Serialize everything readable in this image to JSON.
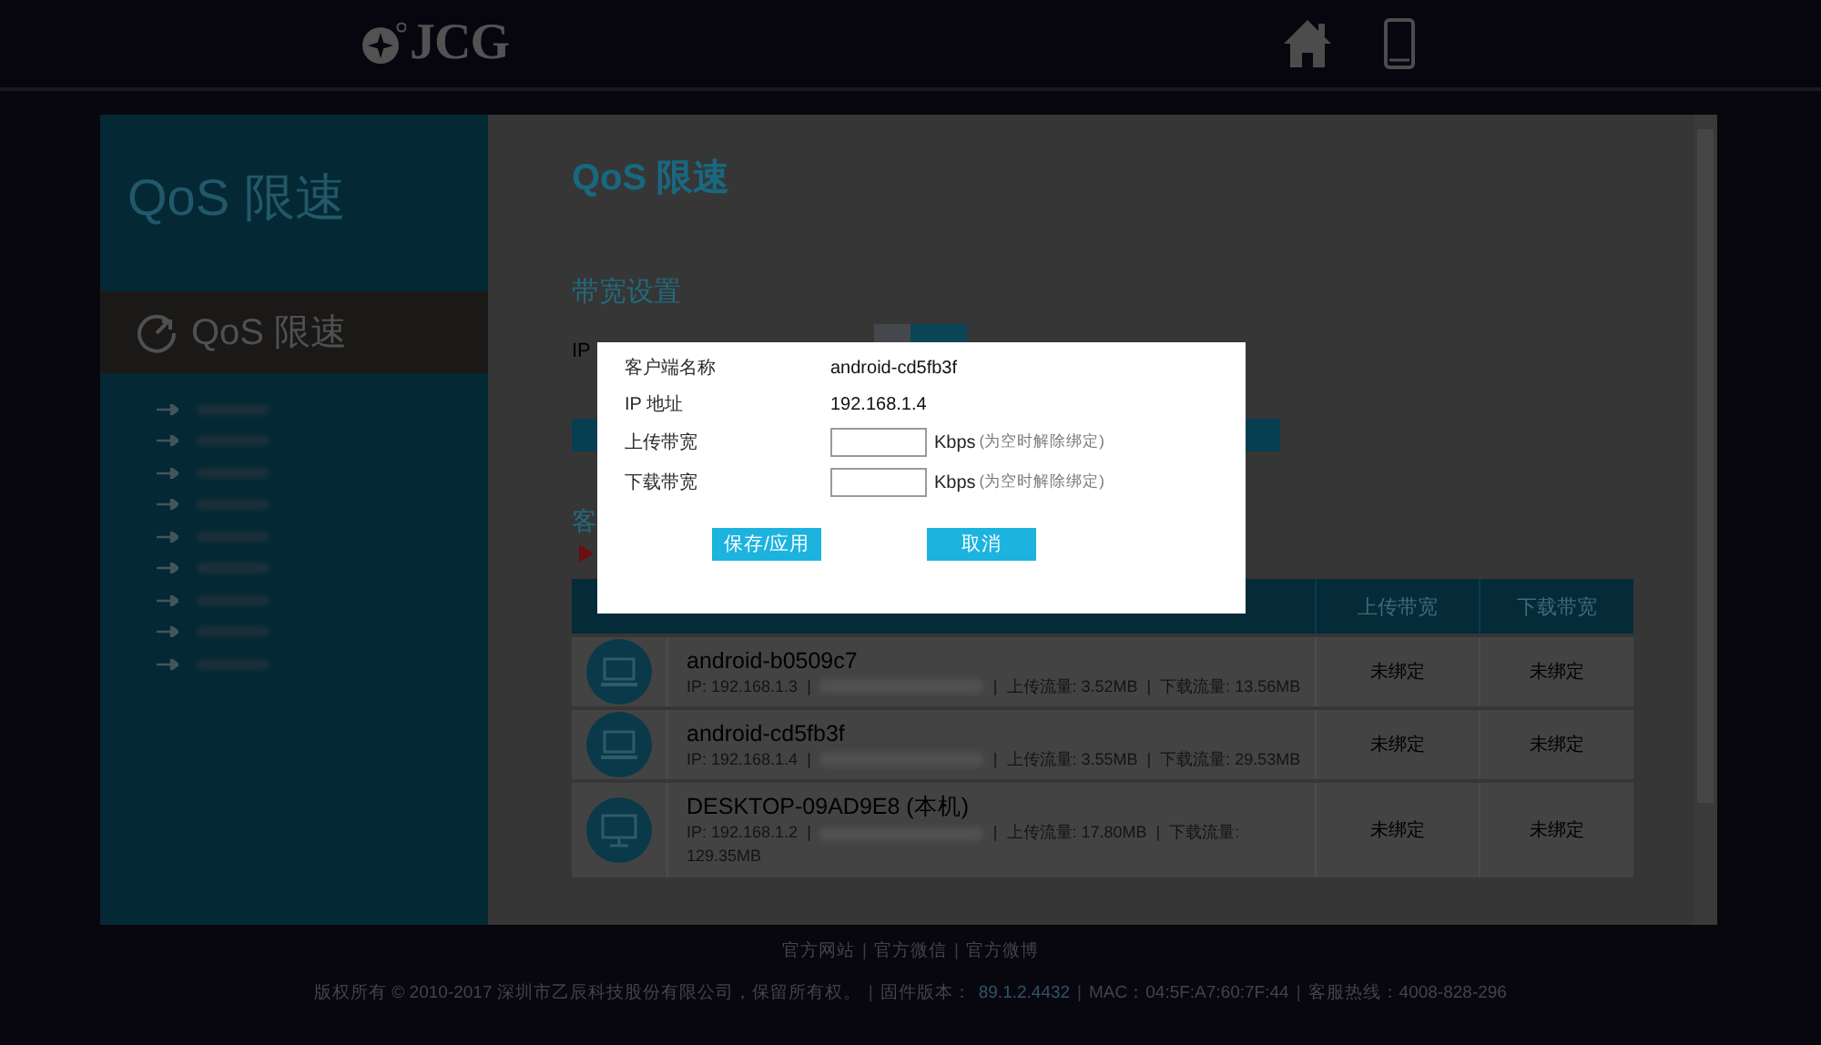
{
  "header": {
    "logo": "JCG"
  },
  "sidebar": {
    "title": "QoS 限速",
    "items": [
      {
        "label": "QoS 限速",
        "selected": true
      }
    ],
    "menu": [
      {
        "kind": "blurred"
      },
      {
        "kind": "blurred"
      },
      {
        "kind": "blurred"
      },
      {
        "kind": "blurred"
      },
      {
        "kind": "blurred"
      },
      {
        "kind": "blurred"
      },
      {
        "kind": "blurred"
      },
      {
        "kind": "blurred"
      },
      {
        "kind": "blurred"
      }
    ]
  },
  "content": {
    "title": "QoS 限速",
    "section": "带宽设置",
    "ip_label": "IP",
    "list_label": "客",
    "table": {
      "columns": [
        "上传带宽",
        "下载带宽"
      ],
      "rows": [
        {
          "kind": "laptop",
          "name": "android-b0509c7",
          "details": [
            {
              "kind": "text",
              "text": "IP: 192.168.1.3"
            },
            {
              "kind": "text",
              "text": "|"
            },
            {
              "kind": "blurred"
            },
            {
              "kind": "text",
              "text": "|"
            },
            {
              "kind": "text",
              "text": "上传流量: 3.52MB"
            },
            {
              "kind": "text",
              "text": "|"
            },
            {
              "kind": "text",
              "text": "下载流量: 13.56MB"
            }
          ],
          "upload": "未绑定",
          "download": "未绑定"
        },
        {
          "kind": "laptop",
          "name": "android-cd5fb3f",
          "details": [
            {
              "kind": "text",
              "text": "IP: 192.168.1.4"
            },
            {
              "kind": "text",
              "text": "|"
            },
            {
              "kind": "blurred"
            },
            {
              "kind": "text",
              "text": "|"
            },
            {
              "kind": "text",
              "text": "上传流量: 3.55MB"
            },
            {
              "kind": "text",
              "text": "|"
            },
            {
              "kind": "text",
              "text": "下载流量: 29.53MB"
            }
          ],
          "upload": "未绑定",
          "download": "未绑定"
        },
        {
          "kind": "desktop",
          "name": "DESKTOP-09AD9E8 (本机)",
          "details": [
            {
              "kind": "text",
              "text": "IP: 192.168.1.2"
            },
            {
              "kind": "text",
              "text": "|"
            },
            {
              "kind": "blurred"
            },
            {
              "kind": "text",
              "text": "|"
            },
            {
              "kind": "text",
              "text": "上传流量: 17.80MB"
            },
            {
              "kind": "text",
              "text": "|"
            },
            {
              "kind": "text",
              "text": "下载流量:"
            },
            {
              "kind": "text",
              "text": "129.35MB"
            }
          ],
          "upload": "未绑定",
          "download": "未绑定"
        }
      ]
    }
  },
  "dialog": {
    "fields": [
      {
        "kind": "text",
        "label": "客户端名称",
        "value": "android-cd5fb3f"
      },
      {
        "kind": "text",
        "label": "IP 地址",
        "value": "192.168.1.4"
      },
      {
        "kind": "input",
        "label": "上传带宽",
        "unit": "Kbps",
        "hint": "(为空时解除绑定)"
      },
      {
        "kind": "input",
        "label": "下载带宽",
        "unit": "Kbps",
        "hint": "(为空时解除绑定)"
      }
    ],
    "buttons": [
      "保存/应用",
      "取消"
    ]
  },
  "footer": {
    "links": [
      {
        "kind": "link",
        "text": "官方网站"
      },
      {
        "kind": "separator",
        "text": "|"
      },
      {
        "kind": "link",
        "text": "官方微信"
      },
      {
        "kind": "separator",
        "text": "|"
      },
      {
        "kind": "link",
        "text": "官方微博"
      }
    ],
    "info": [
      {
        "kind": "text",
        "text": "版权所有 © 2010-2017 深圳市乙辰科技股份有限公司，保留所有权。"
      },
      {
        "kind": "separator",
        "text": "|"
      },
      {
        "kind": "text",
        "text": "固件版本："
      },
      {
        "kind": "link",
        "text": "89.1.2.4432"
      },
      {
        "kind": "separator",
        "text": "|"
      },
      {
        "kind": "text",
        "text": "MAC：04:5F:A7:60:7F:44"
      },
      {
        "kind": "separator",
        "text": "|"
      },
      {
        "kind": "text",
        "text": "客服热线：4008-828-296"
      }
    ]
  }
}
